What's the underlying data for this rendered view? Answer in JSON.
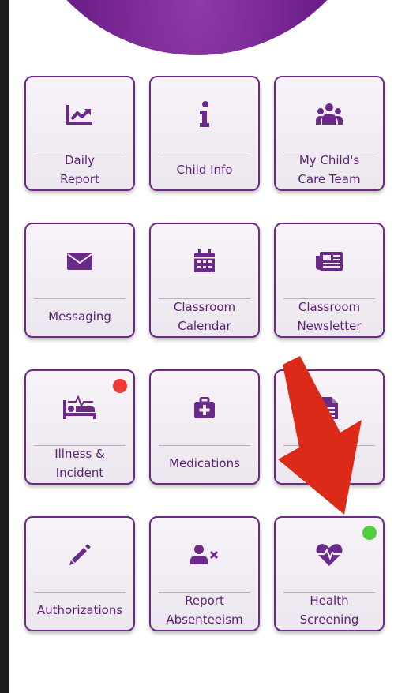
{
  "colors": {
    "brand_purple": "#6b2a87",
    "text_purple": "#5b1f74",
    "alert_red": "#ef3b34",
    "status_green": "#4fd03d",
    "arrow_red": "#dc2a18"
  },
  "tiles": [
    {
      "label": "Daily\nReport",
      "icon": "line-chart-icon"
    },
    {
      "label": "Child Info",
      "icon": "info-icon"
    },
    {
      "label": "My Child's\nCare Team",
      "icon": "users-group-icon"
    },
    {
      "label": "Messaging",
      "icon": "envelope-icon"
    },
    {
      "label": "Classroom\nCalendar",
      "icon": "calendar-icon"
    },
    {
      "label": "Classroom\nNewsletter",
      "icon": "newspaper-icon"
    },
    {
      "label": "Illness &\nIncident",
      "icon": "bed-pulse-icon",
      "badge": "red"
    },
    {
      "label": "Medications",
      "icon": "first-aid-kit-icon"
    },
    {
      "label": "Cl      ons",
      "icon": "document-icon"
    },
    {
      "label": "Authorizations",
      "icon": "pencil-icon"
    },
    {
      "label": "Report\nAbsenteeism",
      "icon": "user-remove-icon"
    },
    {
      "label": "Health\nScreening",
      "icon": "heart-pulse-icon",
      "badge": "green"
    }
  ]
}
